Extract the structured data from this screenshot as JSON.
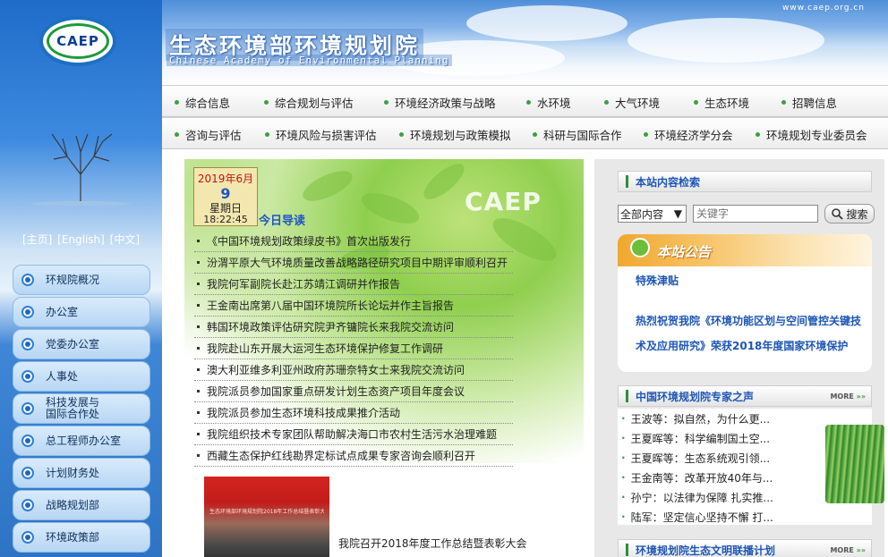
{
  "header": {
    "logo_text": "CAEP",
    "site_title_cn": "生态环境部环境规划院",
    "site_title_en": "Chinese Academy of Environmental Planning",
    "domain": "www.caep.org.cn"
  },
  "lang_links": [
    "[主页]",
    "[English]",
    "[中文]"
  ],
  "nav_row1": [
    "综合信息",
    "综合规划与评估",
    "环境经济政策与战略",
    "水环境",
    "大气环境",
    "生态环境",
    "招聘信息"
  ],
  "nav_row2": [
    "咨询与评估",
    "环境风险与损害评估",
    "环境规划与政策模拟",
    "科研与国际合作",
    "环境经济学分会",
    "环境规划专业委员会"
  ],
  "left_nav": [
    "环规院概况",
    "办公室",
    "党委办公室",
    "人事处",
    "科技发展与\n国际合作处",
    "总工程师办公室",
    "计划财务处",
    "战略规划部",
    "环境政策部"
  ],
  "date_box": {
    "year_month": "2019年6月",
    "day": "9",
    "weekday": "星期日",
    "time": "18:22:45"
  },
  "today_title": "今日导读",
  "center_watermark": "CAEP",
  "news": [
    "《中国环境规划政策绿皮书》首次出版发行",
    "汾渭平原大气环境质量改善战略路径研究项目中期评审顺利召开",
    "我院何军副院长赴江苏靖江调研并作报告",
    "王金南出席第八届中国环境院所长论坛并作主旨报告",
    "韩国环境政策评估研究院尹齐镛院长来我院交流访问",
    "我院赴山东开展大运河生态环境保护修复工作调研",
    "澳大利亚维多利亚州政府苏珊奈特女士来我院交流访问",
    "我院派员参加国家重点研发计划生态资产项目年度会议",
    "我院派员参加生态环境科技成果推介活动",
    "我院组织技术专家团队帮助解决海口市农村生活污水治理难题",
    "西藏生态保护红线勘界定标试点成果专家咨询会顺利召开"
  ],
  "photo": {
    "banner_text": "生态环境部环境规划院2018年工作总结暨表彰大会",
    "caption": "我院召开2018年度工作总结暨表彰大会"
  },
  "search": {
    "heading": "本站内容检索",
    "select_value": "全部内容",
    "placeholder": "关键字",
    "button": "搜索"
  },
  "notice": {
    "banner": "本站公告",
    "item1": "特殊津贴",
    "item2": "热烈祝贺我院《环境功能区划与空间管控关键技术及应用研究》荣获2018年度国家环境保护"
  },
  "experts": {
    "heading": "中国环境规划院专家之声",
    "more": "MORE",
    "more_arrows": "»»",
    "items": [
      "王波等：拟自然，为什么更...",
      "王夏晖等：科学编制国土空...",
      "王夏晖等：生态系统观引领...",
      "王金南等：改革开放40年与...",
      "孙宁：以法律为保障 扎实推...",
      "陆军：坚定信心坚持不懈 打..."
    ]
  },
  "live": {
    "heading": "环境规划院生态文明联播计划",
    "more": "MORE",
    "more_arrows": "»»"
  },
  "colors": {
    "accent_blue": "#1d55b5",
    "green": "#3aa040",
    "date_red": "#c0140e"
  }
}
